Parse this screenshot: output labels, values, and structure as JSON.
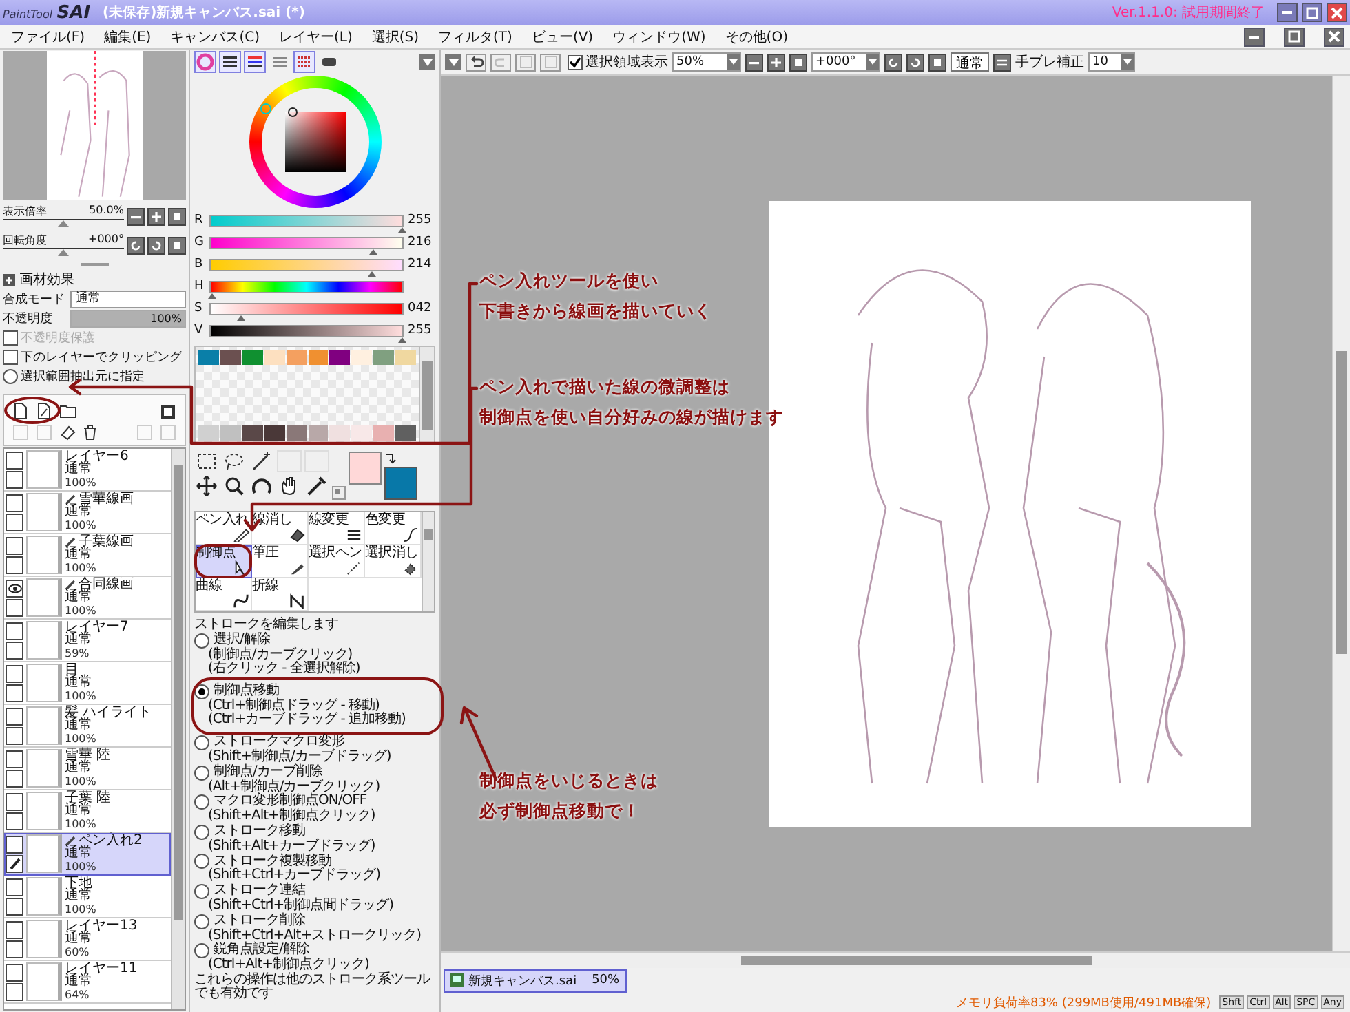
{
  "window": {
    "logo_small": "PaintTool",
    "logo_big": "SAI",
    "title": "(未保存)新規キャンバス.sai (*)",
    "version": "Ver.1.1.0: 試用期間終了"
  },
  "menu": [
    "ファイル(F)",
    "編集(E)",
    "キャンバス(C)",
    "レイヤー(L)",
    "選択(S)",
    "フィルタ(T)",
    "ビュー(V)",
    "ウィンドウ(W)",
    "その他(O)"
  ],
  "toolbar": {
    "selection_display": {
      "label": "選択領域表示",
      "checked": true
    },
    "zoom": "50%",
    "angle": "+000°",
    "mode": "通常",
    "stabilizer_label": "手ブレ補正",
    "stabilizer": "10"
  },
  "navigator": {
    "zoom_label": "表示倍率",
    "zoom": "50.0%",
    "zoom_slider": {
      "level": 0.5
    },
    "angle_label": "回転角度",
    "angle": "+000°",
    "angle_slider": {
      "level": 0.5
    }
  },
  "layer_props": {
    "effects": "画材効果",
    "blend_label": "合成モード",
    "blend": "通常",
    "opacity_label": "不透明度",
    "opacity": "100%",
    "opacity_slider": {
      "level": 1.0
    },
    "options": [
      {
        "kind": "checkbox",
        "label": "不透明度保護",
        "checked": false,
        "disabled": true
      },
      {
        "kind": "checkbox",
        "label": "下のレイヤーでクリッピング",
        "checked": false,
        "disabled": false
      },
      {
        "kind": "radio",
        "label": "選択範囲抽出元に指定",
        "checked": false,
        "disabled": false
      }
    ]
  },
  "layers": [
    {
      "name": "レイヤー6",
      "mode": "通常",
      "opacity": "100%",
      "kind": "raster",
      "visible": false,
      "selected": false
    },
    {
      "name": "雪華線画",
      "mode": "通常",
      "opacity": "100%",
      "kind": "pen",
      "visible": false,
      "selected": false
    },
    {
      "name": "子葉線画",
      "mode": "通常",
      "opacity": "100%",
      "kind": "pen",
      "visible": false,
      "selected": false
    },
    {
      "name": "合同線画",
      "mode": "通常",
      "opacity": "100%",
      "kind": "pen",
      "visible": true,
      "selected": false
    },
    {
      "name": "レイヤー7",
      "mode": "通常",
      "opacity": "59%",
      "kind": "raster",
      "visible": false,
      "selected": false
    },
    {
      "name": "目",
      "mode": "通常",
      "opacity": "100%",
      "kind": "raster",
      "visible": false,
      "selected": false
    },
    {
      "name": "髪 ハイライト",
      "mode": "通常",
      "opacity": "100%",
      "kind": "raster",
      "visible": false,
      "selected": false
    },
    {
      "name": "雪華 陸",
      "mode": "通常",
      "opacity": "100%",
      "kind": "raster",
      "visible": false,
      "selected": false
    },
    {
      "name": "子葉 陸",
      "mode": "通常",
      "opacity": "100%",
      "kind": "raster",
      "visible": false,
      "selected": false
    },
    {
      "name": "ペン入れ2",
      "mode": "通常",
      "opacity": "100%",
      "kind": "pen",
      "visible": false,
      "selected": true
    },
    {
      "name": "下地",
      "mode": "通常",
      "opacity": "100%",
      "kind": "raster",
      "visible": false,
      "selected": false
    },
    {
      "name": "レイヤー13",
      "mode": "通常",
      "opacity": "60%",
      "kind": "raster",
      "visible": false,
      "selected": false
    },
    {
      "name": "レイヤー11",
      "mode": "通常",
      "opacity": "64%",
      "kind": "raster",
      "visible": false,
      "selected": false
    }
  ],
  "sliders": [
    {
      "label": "R",
      "value": "255",
      "level": 1.0
    },
    {
      "label": "G",
      "value": "216",
      "level": 0.85
    },
    {
      "label": "B",
      "value": "214",
      "level": 0.84
    },
    {
      "label": "H",
      "level": 0.01
    },
    {
      "label": "S",
      "value": "042",
      "level": 0.16
    },
    {
      "label": "V",
      "value": "255",
      "level": 1.0
    }
  ],
  "swatches": [
    {
      "color": "#0a7fa8"
    },
    {
      "color": "#6b5050"
    },
    {
      "color": "#109030"
    },
    {
      "color": "#fde0c0"
    },
    {
      "color": "#f4a060"
    },
    {
      "color": "#f09030"
    },
    {
      "color": "#800080"
    },
    {
      "color": "#fff0e0"
    },
    {
      "color": "#80a080"
    },
    {
      "color": "#f0d8a0"
    }
  ],
  "swatches_lower": [
    {
      "color": "#d0d0d0"
    },
    {
      "color": "#c0c0c0"
    },
    {
      "color": "#5a4848"
    },
    {
      "color": "#4a3838"
    },
    {
      "color": "#8a7878"
    },
    {
      "color": "#b8a8a8"
    },
    {
      "color": "#f0e0e0"
    },
    {
      "color": "#f8e8e8"
    },
    {
      "color": "#e8b0b0"
    },
    {
      "color": "#606060"
    }
  ],
  "current_colors": [
    {
      "color": "#ffd8d8"
    },
    {
      "color": "#0878a8"
    }
  ],
  "pen_tools": [
    {
      "label": "ペン入れ",
      "selected": false
    },
    {
      "label": "線消し",
      "selected": false
    },
    {
      "label": "線変更",
      "selected": false
    },
    {
      "label": "色変更",
      "selected": false
    },
    {
      "label": "制御点",
      "selected": true
    },
    {
      "label": "筆圧",
      "selected": false
    },
    {
      "label": "選択ペン",
      "selected": false
    },
    {
      "label": "選択消し",
      "selected": false
    },
    {
      "label": "曲線",
      "selected": false
    },
    {
      "label": "折線",
      "selected": false
    }
  ],
  "stroke_options": {
    "header": "ストロークを編集します",
    "items": [
      {
        "label": "選択/解除",
        "hints": [
          "(制御点/カーブクリック)",
          "(右クリック - 全選択解除)"
        ],
        "selected": false
      },
      {
        "label": "制御点移動",
        "hints": [
          "(Ctrl+制御点ドラッグ - 移動)",
          "(Ctrl+カーブドラッグ - 追加移動)"
        ],
        "selected": true
      },
      {
        "label": "ストロークマクロ変形",
        "hints": [
          "(Shift+制御点/カーブドラッグ)"
        ],
        "selected": false
      },
      {
        "label": "制御点/カーブ削除",
        "hints": [
          "(Alt+制御点/カーブクリック)"
        ],
        "selected": false
      },
      {
        "label": "マクロ変形制御点ON/OFF",
        "hints": [
          "(Shift+Alt+制御点クリック)"
        ],
        "selected": false
      },
      {
        "label": "ストローク移動",
        "hints": [
          "(Shift+Alt+カーブドラッグ)"
        ],
        "selected": false
      },
      {
        "label": "ストローク複製移動",
        "hints": [
          "(Shift+Ctrl+カーブドラッグ)"
        ],
        "selected": false
      },
      {
        "label": "ストローク連結",
        "hints": [
          "(Shift+Ctrl+制御点間ドラッグ)"
        ],
        "selected": false
      },
      {
        "label": "ストローク削除",
        "hints": [
          "(Shift+Ctrl+Alt+ストロークリック)"
        ],
        "selected": false
      },
      {
        "label": "鋭角点設定/解除",
        "hints": [
          "(Ctrl+Alt+制御点クリック)"
        ],
        "selected": false
      }
    ],
    "footer": "これらの操作は他のストローク系ツールでも有効です"
  },
  "canvas_tabs": [
    {
      "name": "新規キャンバス.sai",
      "zoom": "50%",
      "selected": true
    }
  ],
  "status_bar": {
    "memory": "メモリ負荷率83% (299MB使用/491MB確保)",
    "keys": [
      "Shft",
      "Ctrl",
      "Alt",
      "SPC",
      "Any"
    ]
  },
  "annotations": [
    {
      "lines": [
        "ペン入れツールを使い",
        "下書きから線画を描いていく"
      ]
    },
    {
      "lines": [
        "ペン入れで描いた線の微調整は",
        "制御点を使い自分好みの線が描けます"
      ]
    },
    {
      "lines": [
        "制御点をいじるときは",
        "必ず制御点移動で！"
      ]
    }
  ]
}
